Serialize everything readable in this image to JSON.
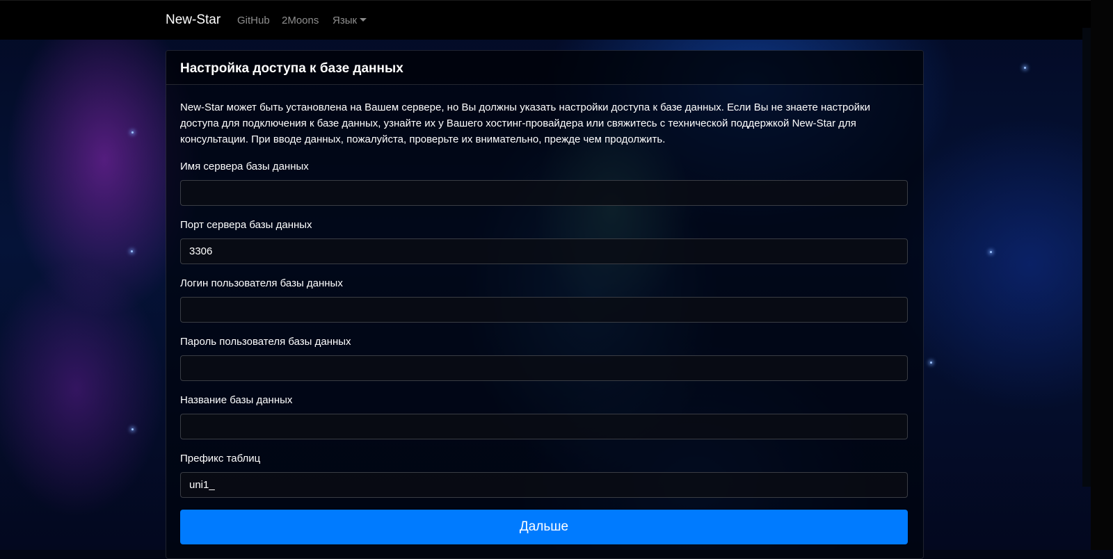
{
  "navbar": {
    "brand": "New-Star",
    "links": [
      "GitHub",
      "2Moons",
      "Язык"
    ]
  },
  "card": {
    "title": "Настройка доступа к базе данных",
    "intro": "New-Star может быть установлена на Вашем сервере, но Вы должны указать настройки доступа к базе данных. Если Вы не знаете настройки доступа для подключения к базе данных, узнайте их у Вашего хостинг-провайдера или свяжитесь с технической поддержкой New-Star для консультации. При вводе данных, пожалуйста, проверьте их внимательно, прежде чем продолжить."
  },
  "fields": [
    {
      "label": "Имя сервера базы данных",
      "value": ""
    },
    {
      "label": "Порт сервера базы данных",
      "value": "3306"
    },
    {
      "label": "Логин пользователя базы данных",
      "value": ""
    },
    {
      "label": "Пароль пользователя базы данных",
      "value": ""
    },
    {
      "label": "Название базы данных",
      "value": ""
    },
    {
      "label": "Префикс таблиц",
      "value": "uni1_"
    }
  ],
  "submit_label": "Дальше",
  "colors": {
    "accent": "#007bff",
    "navbar_bg": "#000000"
  }
}
